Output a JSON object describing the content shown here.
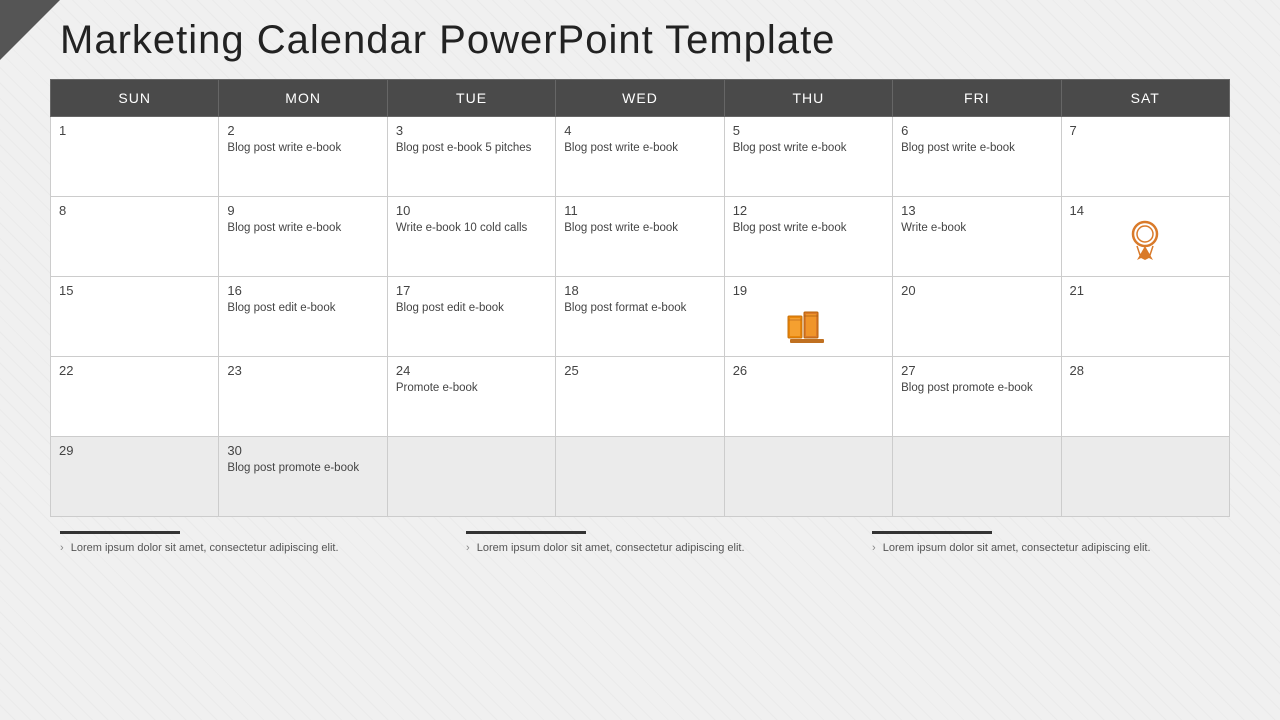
{
  "title": "Marketing Calendar PowerPoint Template",
  "headers": [
    "SUN",
    "MON",
    "TUE",
    "WED",
    "THU",
    "FRI",
    "SAT"
  ],
  "weeks": [
    [
      {
        "day": "1",
        "text": ""
      },
      {
        "day": "2",
        "text": "Blog post write e-book"
      },
      {
        "day": "3",
        "text": "Blog post e-book 5 pitches"
      },
      {
        "day": "4",
        "text": "Blog post write e-book"
      },
      {
        "day": "5",
        "text": "Blog post write e-book"
      },
      {
        "day": "6",
        "text": "Blog post write e-book"
      },
      {
        "day": "7",
        "text": ""
      }
    ],
    [
      {
        "day": "8",
        "text": ""
      },
      {
        "day": "9",
        "text": "Blog post write e-book"
      },
      {
        "day": "10",
        "text": "Write e-book 10 cold calls"
      },
      {
        "day": "11",
        "text": "Blog post write e-book"
      },
      {
        "day": "12",
        "text": "Blog post write e-book"
      },
      {
        "day": "13",
        "text": "Write e-book"
      },
      {
        "day": "14",
        "text": "",
        "icon": "award"
      }
    ],
    [
      {
        "day": "15",
        "text": ""
      },
      {
        "day": "16",
        "text": "Blog post edit e-book"
      },
      {
        "day": "17",
        "text": "Blog post edit e-book"
      },
      {
        "day": "18",
        "text": "Blog post format e-book"
      },
      {
        "day": "19",
        "text": "",
        "icon": "books"
      },
      {
        "day": "20",
        "text": ""
      },
      {
        "day": "21",
        "text": ""
      }
    ],
    [
      {
        "day": "22",
        "text": ""
      },
      {
        "day": "23",
        "text": ""
      },
      {
        "day": "24",
        "text": "Promote e-book"
      },
      {
        "day": "25",
        "text": ""
      },
      {
        "day": "26",
        "text": ""
      },
      {
        "day": "27",
        "text": "Blog post promote e-book"
      },
      {
        "day": "28",
        "text": ""
      }
    ],
    [
      {
        "day": "29",
        "text": ""
      },
      {
        "day": "30",
        "text": "Blog post promote e-book"
      },
      {
        "day": "",
        "text": ""
      },
      {
        "day": "",
        "text": ""
      },
      {
        "day": "",
        "text": ""
      },
      {
        "day": "",
        "text": ""
      },
      {
        "day": "",
        "text": ""
      }
    ]
  ],
  "footer": [
    {
      "text": "Lorem ipsum dolor sit amet, consectetur adipiscing elit."
    },
    {
      "text": "Lorem ipsum dolor sit amet, consectetur adipiscing elit."
    },
    {
      "text": "Lorem ipsum dolor sit amet, consectetur adipiscing elit."
    }
  ]
}
